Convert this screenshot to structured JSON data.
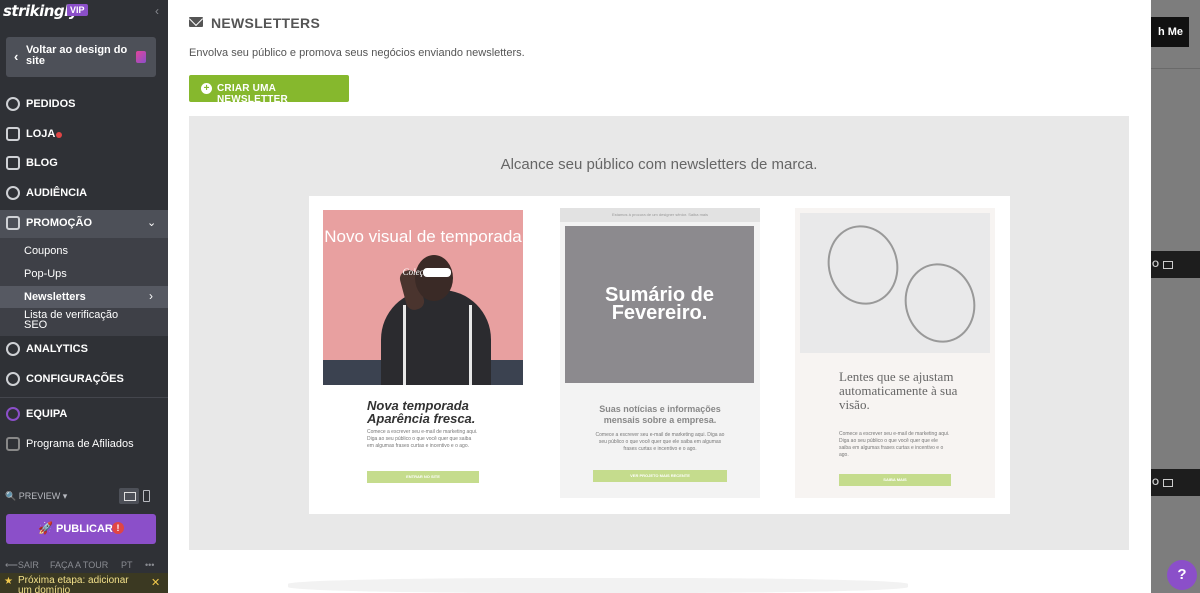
{
  "sidebar": {
    "logo": "strikingly",
    "vip_badge": "VIP",
    "back_button": "Voltar ao design do site",
    "nav": [
      {
        "label": "PEDIDOS",
        "icon": "orders-icon"
      },
      {
        "label": "LOJA",
        "icon": "store-icon",
        "has_dot": true
      },
      {
        "label": "BLOG",
        "icon": "pen-icon"
      },
      {
        "label": "AUDIÊNCIA",
        "icon": "audience-icon"
      },
      {
        "label": "PROMOÇÃO",
        "icon": "megaphone-icon",
        "expanded": true
      },
      {
        "label": "ANALYTICS",
        "icon": "analytics-icon"
      },
      {
        "label": "CONFIGURAÇÕES",
        "icon": "gear-icon"
      },
      {
        "label": "EQUIPA",
        "icon": "team-icon"
      },
      {
        "label": "Programa de Afiliados",
        "icon": "trophy-icon"
      }
    ],
    "promo_sub": [
      "Coupons",
      "Pop-Ups",
      "Newsletters",
      "Lista de verificação SEO"
    ],
    "preview_label": "PREVIEW",
    "publish_label": "PUBLICAR",
    "publish_warning": "!",
    "footer": {
      "exit": "SAIR",
      "tour": "FAÇA A TOUR",
      "lang": "PT",
      "more": "•••"
    },
    "next_step": "Próxima etapa: adicionar um domínio"
  },
  "modal": {
    "title": "NEWSLETTERS",
    "description": "Envolva seu público e promova seus negócios enviando newsletters.",
    "create_button": "CRIAR UMA NEWSLETTER",
    "showcase_title": "Alcance seu público com newsletters de marca.",
    "cards": [
      {
        "headline": "Novo visual de temporada",
        "subline": "Coleção de",
        "heading": "Nova temporada Aparência fresca.",
        "body": "Comece a escrever seu e-mail de marketing aqui. Diga ao seu público o que você quer que saiba em algumas frases curtas e incentivo e o ago.",
        "button": "ENTRAR NO SITE"
      },
      {
        "top_bar": "Estamos à procura de um designer sênior. Saiba mais",
        "headline": "Sumário de Fevereiro.",
        "heading": "Suas notícias e informações mensais sobre a empresa.",
        "body": "Comece a escrever seu e-mail de marketing aqui. Diga ao seu público o que você quer que ele saiba em algumas frases curtas e incentivo e o ago.",
        "button": "VER PROJETO MAIS RECENTE"
      },
      {
        "heading": "Lentes que se ajustam automaticamente à sua visão.",
        "body": "Comece a escrever seu e-mail de marketing aqui. Diga ao seu público o que você quer que ele saiba em algumas frases curtas e incentivo e o ago.",
        "button": "SAIBA MAIS"
      }
    ]
  },
  "background": {
    "button": "h Me",
    "band_text": "O"
  },
  "help_button": "?"
}
